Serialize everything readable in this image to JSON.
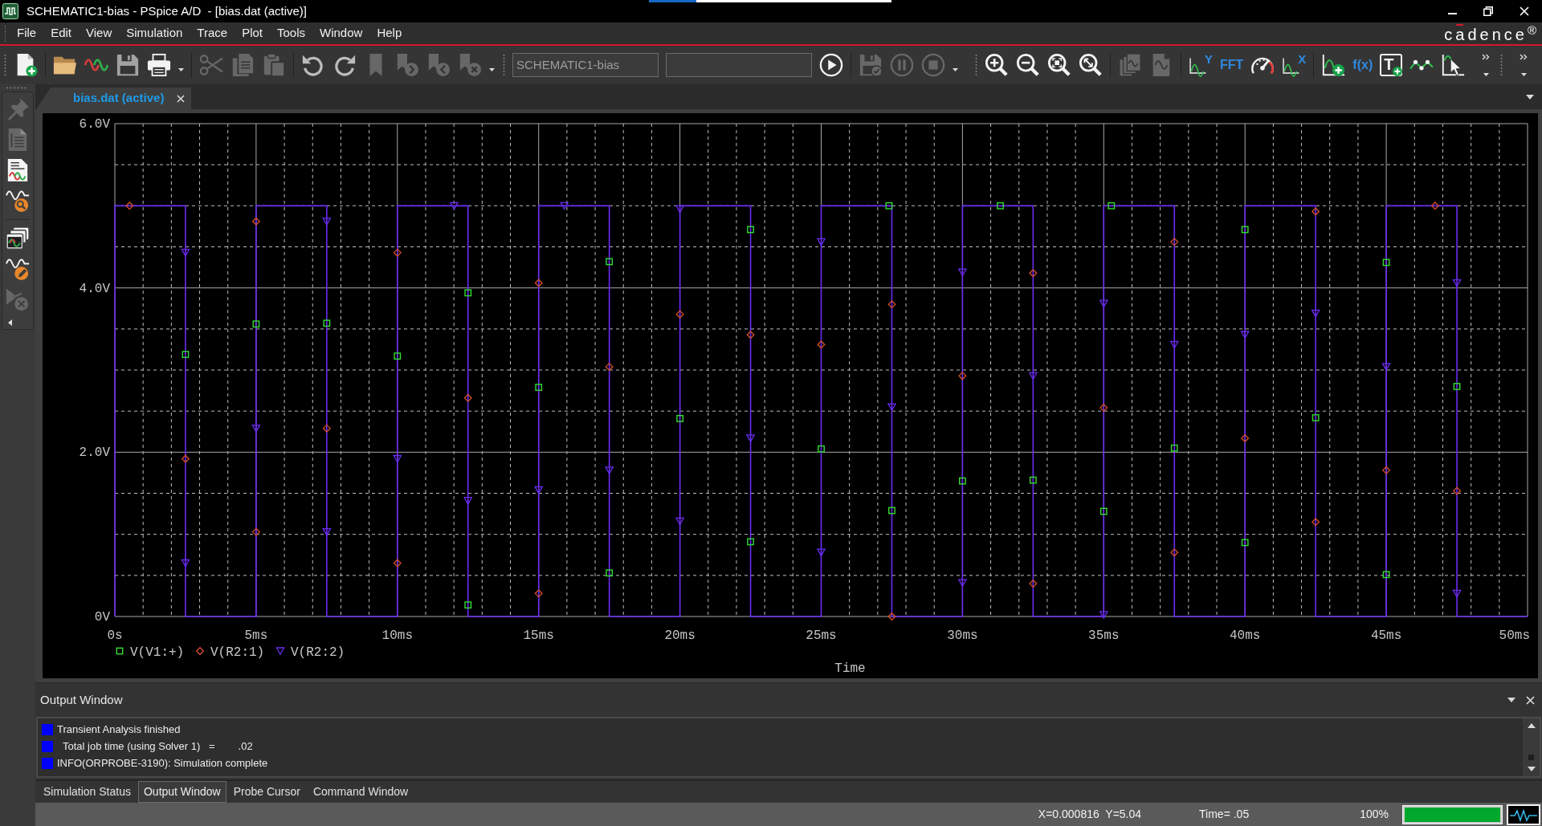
{
  "window": {
    "title": "SCHEMATIC1-bias - PSpice A/D  - [bias.dat (active)]"
  },
  "menu": {
    "items": [
      "File",
      "Edit",
      "View",
      "Simulation",
      "Trace",
      "Plot",
      "Tools",
      "Window",
      "Help"
    ],
    "logo": "cadence$^{®}$"
  },
  "toolbar": {
    "groups": [
      [
        {
          "kind": "icon",
          "disabled": false
        },
        {
          "kind": "separator"
        },
        {
          "kind": "icon",
          "disabled": false
        },
        {
          "kind": "icon",
          "disabled": false
        },
        {
          "kind": "icon",
          "disabled": false
        },
        {
          "kind": "icon",
          "disabled": false
        },
        {
          "kind": "caret"
        },
        {
          "kind": "separator"
        },
        {
          "kind": "icon",
          "disabled": true
        },
        {
          "kind": "icon",
          "disabled": true
        },
        {
          "kind": "icon",
          "disabled": true
        },
        {
          "kind": "separator"
        },
        {
          "kind": "icon",
          "disabled": false
        },
        {
          "kind": "icon",
          "disabled": false
        },
        {
          "kind": "icon",
          "disabled": true
        },
        {
          "kind": "icon",
          "disabled": true
        },
        {
          "kind": "icon",
          "disabled": true
        },
        {
          "kind": "icon",
          "disabled": true
        },
        {
          "kind": "caret"
        }
      ],
      [
        {
          "kind": "field",
          "value": "SCHEMATIC1-bias"
        },
        {
          "kind": "field"
        },
        {
          "kind": "icon",
          "disabled": false
        },
        {
          "kind": "separator"
        },
        {
          "kind": "icon",
          "disabled": true
        },
        {
          "kind": "icon",
          "disabled": true
        },
        {
          "kind": "icon",
          "disabled": true
        },
        {
          "kind": "caret"
        }
      ],
      [
        {
          "kind": "icon",
          "disabled": false
        },
        {
          "kind": "icon",
          "disabled": false
        },
        {
          "kind": "icon",
          "disabled": false
        },
        {
          "kind": "icon",
          "disabled": false
        },
        {
          "kind": "separator"
        },
        {
          "kind": "icon",
          "disabled": true
        },
        {
          "kind": "icon",
          "disabled": true
        },
        {
          "kind": "separator"
        },
        {
          "kind": "icon_text",
          "label": "Y",
          "disabled": false
        },
        {
          "kind": "text",
          "label": "FFT",
          "disabled": false
        },
        {
          "kind": "icon",
          "disabled": false
        },
        {
          "kind": "icon_text",
          "label": "X",
          "disabled": false
        },
        {
          "kind": "separator"
        },
        {
          "kind": "icon",
          "disabled": false
        },
        {
          "kind": "text",
          "label": "f(x)",
          "disabled": false
        },
        {
          "kind": "icon_text",
          "label": "T",
          "disabled": false
        },
        {
          "kind": "icon",
          "disabled": false
        },
        {
          "kind": "icon",
          "disabled": false
        },
        {
          "kind": "overflow"
        }
      ],
      [
        {
          "kind": "overflow"
        }
      ]
    ]
  },
  "sidebar": {
    "items": [
      {
        "disabled": true
      },
      {
        "disabled": true
      },
      {
        "disabled": false
      },
      {
        "disabled": false
      },
      {
        "disabled": false
      },
      {
        "disabled": false
      },
      {
        "disabled": true
      }
    ]
  },
  "document_tabs": [
    {
      "label": "bias.dat (active)",
      "selected": true
    }
  ],
  "plot": {
    "chart_data": {
      "type": "line",
      "xlabel": "Time",
      "xlim": [
        0,
        50
      ],
      "ylim": [
        0,
        6
      ],
      "grid": true,
      "legend": "bottom",
      "xticks": [
        {
          "value": 0,
          "label": "0s"
        },
        {
          "value": 5,
          "label": "5ms"
        },
        {
          "value": 10,
          "label": "10ms"
        },
        {
          "value": 15,
          "label": "15ms"
        },
        {
          "value": 20,
          "label": "20ms"
        },
        {
          "value": 25,
          "label": "25ms"
        },
        {
          "value": 30,
          "label": "30ms"
        },
        {
          "value": 35,
          "label": "35ms"
        },
        {
          "value": 40,
          "label": "40ms"
        },
        {
          "value": 45,
          "label": "45ms"
        },
        {
          "value": 50,
          "label": "50ms"
        }
      ],
      "yticks": [
        {
          "value": 0,
          "label": "0V"
        },
        {
          "value": 2,
          "label": "2.0V"
        },
        {
          "value": 4,
          "label": "4.0V"
        },
        {
          "value": 6,
          "label": "6.0V"
        }
      ],
      "x": [
        0,
        0,
        0.52,
        2.5,
        2.5,
        2.5,
        2.5,
        2.5,
        2.5,
        5,
        5,
        5,
        5,
        5,
        5,
        7.5,
        7.5,
        7.5,
        7.5,
        7.5,
        7.5,
        10,
        10,
        10,
        10,
        10,
        10,
        12.01,
        12.5,
        12.5,
        12.5,
        12.5,
        12.5,
        12.5,
        15,
        15,
        15,
        15,
        15,
        15,
        15.91,
        17.5,
        17.5,
        17.5,
        17.5,
        17.5,
        17.5,
        20,
        20,
        20,
        20,
        20,
        20,
        22.5,
        22.5,
        22.5,
        22.5,
        22.5,
        22.5,
        25,
        25,
        25,
        25,
        25,
        25,
        27.4,
        27.5,
        27.5,
        27.5,
        27.5,
        27.5,
        30,
        30,
        30,
        30,
        30,
        30,
        31.34,
        32.5,
        32.5,
        32.5,
        32.5,
        32.5,
        32.5,
        35,
        35,
        35,
        35,
        35,
        35,
        35.27,
        37.5,
        37.5,
        37.5,
        37.5,
        37.5,
        37.5,
        40,
        40,
        40,
        40,
        40,
        40,
        42.5,
        42.5,
        42.5,
        42.5,
        42.5,
        42.5,
        45,
        45,
        45,
        45,
        45,
        45,
        46.73,
        47.5,
        47.5,
        47.5,
        47.5,
        47.5,
        47.5,
        50
      ],
      "series": [
        {
          "name": "V(V1:+)",
          "type": "scatter",
          "color": "#33dd33",
          "marker": "square",
          "values": [
            null,
            null,
            null,
            null,
            null,
            3.19,
            null,
            null,
            null,
            null,
            null,
            null,
            3.56,
            null,
            null,
            null,
            null,
            3.57,
            null,
            null,
            null,
            null,
            null,
            null,
            3.17,
            null,
            null,
            null,
            null,
            3.94,
            null,
            null,
            0.14,
            null,
            null,
            null,
            null,
            2.79,
            null,
            null,
            null,
            null,
            4.32,
            null,
            null,
            0.53,
            null,
            null,
            null,
            2.41,
            null,
            null,
            null,
            null,
            4.71,
            null,
            null,
            0.91,
            null,
            null,
            null,
            2.04,
            null,
            null,
            null,
            5,
            null,
            null,
            null,
            1.29,
            null,
            null,
            null,
            1.65,
            null,
            null,
            null,
            5,
            null,
            null,
            null,
            1.66,
            null,
            null,
            null,
            null,
            1.28,
            null,
            null,
            null,
            5,
            null,
            null,
            null,
            2.05,
            null,
            null,
            null,
            0.9,
            null,
            null,
            4.71,
            null,
            null,
            null,
            null,
            2.42,
            null,
            null,
            null,
            0.51,
            null,
            null,
            4.31,
            null,
            null,
            null,
            null,
            2.8,
            null,
            null,
            null,
            null
          ]
        },
        {
          "name": "V(R2:1)",
          "type": "scatter",
          "color": "#d8502a",
          "marker": "diamond",
          "values": [
            null,
            null,
            5,
            null,
            null,
            null,
            1.92,
            null,
            null,
            null,
            1.03,
            null,
            null,
            4.81,
            null,
            null,
            null,
            null,
            2.29,
            null,
            null,
            null,
            0.65,
            null,
            null,
            4.43,
            null,
            null,
            null,
            null,
            2.66,
            null,
            null,
            null,
            null,
            0.28,
            null,
            null,
            4.06,
            null,
            null,
            null,
            null,
            3.04,
            null,
            null,
            null,
            null,
            null,
            null,
            3.68,
            null,
            null,
            null,
            null,
            3.43,
            null,
            null,
            null,
            null,
            null,
            null,
            3.31,
            null,
            null,
            null,
            null,
            3.8,
            null,
            null,
            0,
            null,
            null,
            null,
            2.93,
            null,
            null,
            null,
            null,
            4.18,
            null,
            null,
            0.4,
            null,
            null,
            null,
            null,
            2.54,
            null,
            null,
            null,
            null,
            4.56,
            null,
            null,
            0.78,
            null,
            null,
            null,
            2.17,
            null,
            null,
            null,
            null,
            4.93,
            null,
            null,
            1.15,
            null,
            null,
            null,
            1.78,
            null,
            null,
            null,
            5,
            null,
            null,
            null,
            1.53,
            null,
            null,
            null
          ]
        },
        {
          "name": "V(R2:2)",
          "type": "scatter",
          "color": "#6a2cf0",
          "marker": "triangle",
          "values": [
            null,
            null,
            null,
            null,
            4.43,
            null,
            null,
            0.65,
            null,
            null,
            null,
            2.29,
            null,
            null,
            null,
            null,
            4.81,
            null,
            null,
            1.03,
            null,
            null,
            null,
            1.92,
            null,
            null,
            null,
            5,
            null,
            null,
            null,
            1.41,
            null,
            null,
            null,
            null,
            1.54,
            null,
            null,
            null,
            5,
            null,
            null,
            null,
            1.78,
            null,
            null,
            null,
            1.16,
            null,
            null,
            4.96,
            null,
            null,
            null,
            null,
            2.17,
            null,
            null,
            null,
            0.78,
            null,
            null,
            4.56,
            null,
            null,
            null,
            null,
            2.55,
            null,
            null,
            null,
            0.41,
            null,
            null,
            4.19,
            null,
            null,
            null,
            null,
            2.93,
            null,
            null,
            null,
            null,
            0.02,
            null,
            null,
            3.81,
            null,
            null,
            null,
            null,
            3.31,
            null,
            null,
            null,
            null,
            null,
            null,
            3.43,
            null,
            null,
            null,
            null,
            3.69,
            null,
            null,
            null,
            null,
            null,
            null,
            3.04,
            null,
            null,
            null,
            null,
            4.06,
            null,
            null,
            0.28,
            null,
            null
          ]
        },
        {
          "type": "line",
          "color": "#6a2cf0",
          "marker": "none",
          "values": [
            0,
            5,
            5,
            5,
            4.43,
            3.19,
            1.92,
            0.65,
            0,
            0,
            1.03,
            2.29,
            3.56,
            4.81,
            5,
            5,
            4.81,
            3.57,
            2.29,
            1.03,
            0,
            0,
            0.65,
            1.92,
            3.17,
            4.43,
            5,
            5,
            5,
            3.94,
            2.66,
            1.41,
            0.14,
            0,
            0,
            0.28,
            1.54,
            2.79,
            4.06,
            5,
            5,
            5,
            4.32,
            3.04,
            1.78,
            0.53,
            0,
            0,
            1.16,
            2.41,
            3.68,
            4.96,
            5,
            5,
            4.71,
            3.43,
            2.17,
            0.91,
            0,
            0,
            0.78,
            2.04,
            3.31,
            4.56,
            5,
            5,
            5,
            3.8,
            2.55,
            1.29,
            0,
            0,
            0.41,
            1.65,
            2.93,
            4.19,
            5,
            5,
            5,
            4.18,
            2.93,
            1.66,
            0.4,
            0,
            0,
            0.02,
            1.28,
            2.54,
            3.81,
            5,
            5,
            5,
            4.56,
            3.31,
            2.05,
            0.78,
            0,
            0,
            0.9,
            2.17,
            3.43,
            4.71,
            5,
            5,
            4.93,
            3.69,
            2.42,
            1.15,
            0,
            0,
            0.51,
            1.78,
            3.04,
            4.31,
            5,
            5,
            5,
            4.06,
            2.8,
            1.53,
            0.28,
            0,
            0
          ]
        }
      ]
    }
  },
  "output_window": {
    "title": "Output Window",
    "lines": [
      "Transient Analysis finished",
      "  Total job time (using Solver 1)   =        .02",
      "INFO(ORPROBE-3190): Simulation complete"
    ],
    "tabs": [
      {
        "label": "Simulation Status",
        "selected": false
      },
      {
        "label": "Output Window",
        "selected": true
      },
      {
        "label": "Probe Cursor",
        "selected": false
      },
      {
        "label": "Command Window",
        "selected": false
      }
    ]
  },
  "status_bar": {
    "cursor": "X=0.000816  Y=5.04",
    "time": "Time= .05",
    "progress": {
      "label": "100%",
      "level": 1
    }
  }
}
